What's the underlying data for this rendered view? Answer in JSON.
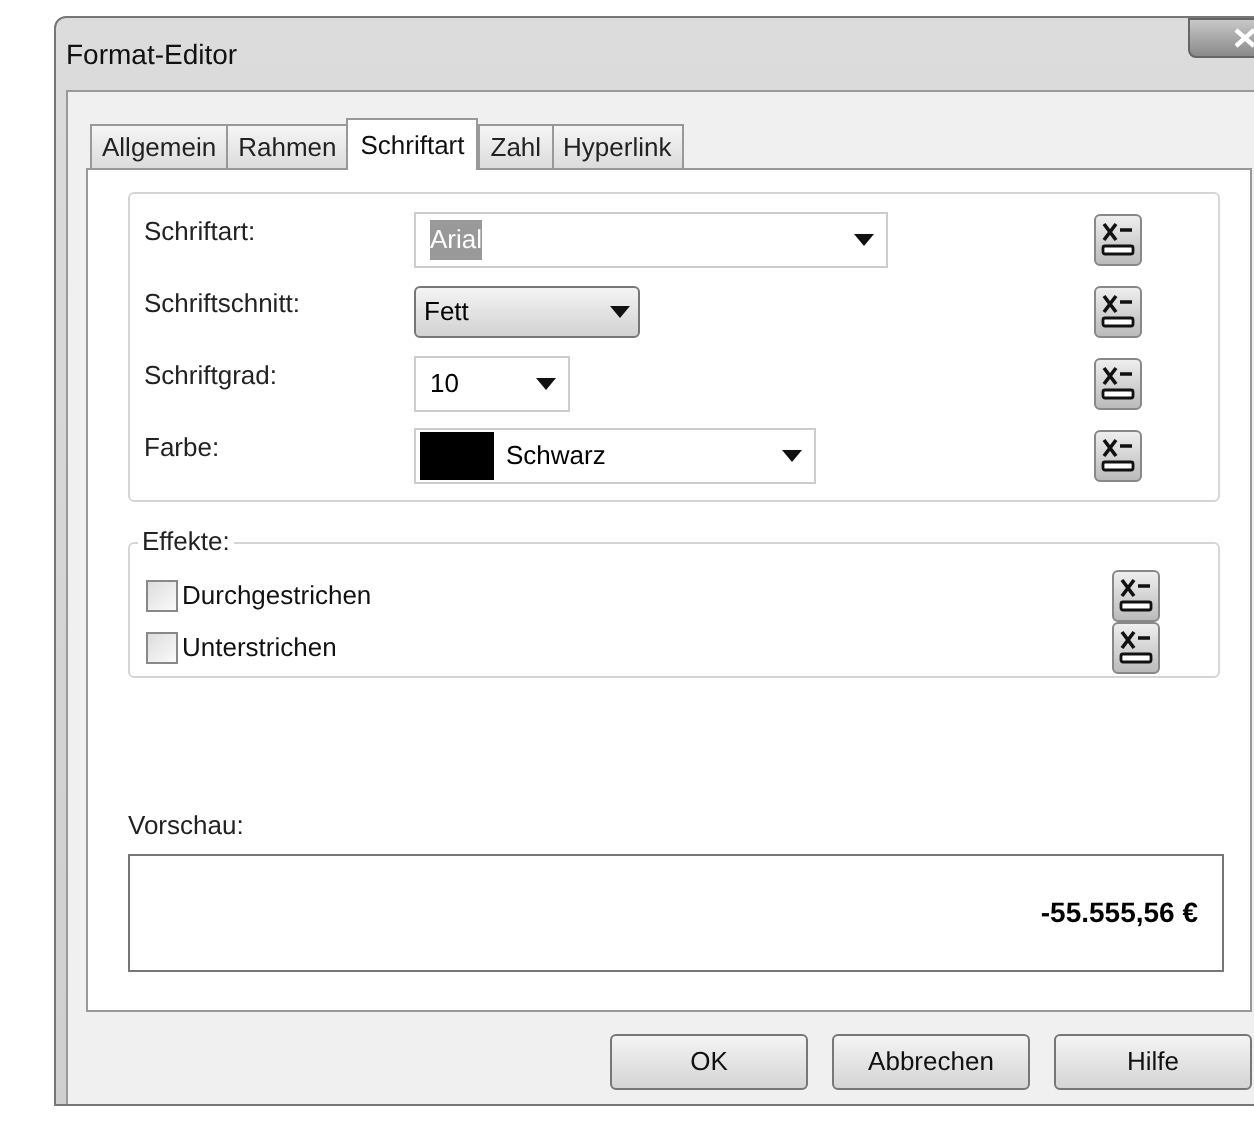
{
  "window": {
    "title": "Format-Editor"
  },
  "tabs": [
    {
      "label": "Allgemein",
      "selected": false
    },
    {
      "label": "Rahmen",
      "selected": false
    },
    {
      "label": "Schriftart",
      "selected": true
    },
    {
      "label": "Zahl",
      "selected": false
    },
    {
      "label": "Hyperlink",
      "selected": false
    }
  ],
  "font_fields": [
    {
      "label": "Schriftart:",
      "kind": "editable",
      "value": "Arial",
      "text_selected": true
    },
    {
      "label": "Schriftschnitt:",
      "kind": "button",
      "value": "Fett"
    },
    {
      "label": "Schriftgrad:",
      "kind": "editable",
      "value": "10",
      "text_selected": false
    },
    {
      "label": "Farbe:",
      "kind": "color",
      "value": "Schwarz",
      "color": "#000000"
    }
  ],
  "effects": {
    "legend": "Effekte:",
    "items": [
      {
        "label": "Durchgestrichen",
        "checked": false
      },
      {
        "label": "Unterstrichen",
        "checked": false
      }
    ]
  },
  "preview": {
    "label": "Vorschau:",
    "value": "-55.555,56 €"
  },
  "buttons": [
    "OK",
    "Abbrechen",
    "Hilfe"
  ]
}
